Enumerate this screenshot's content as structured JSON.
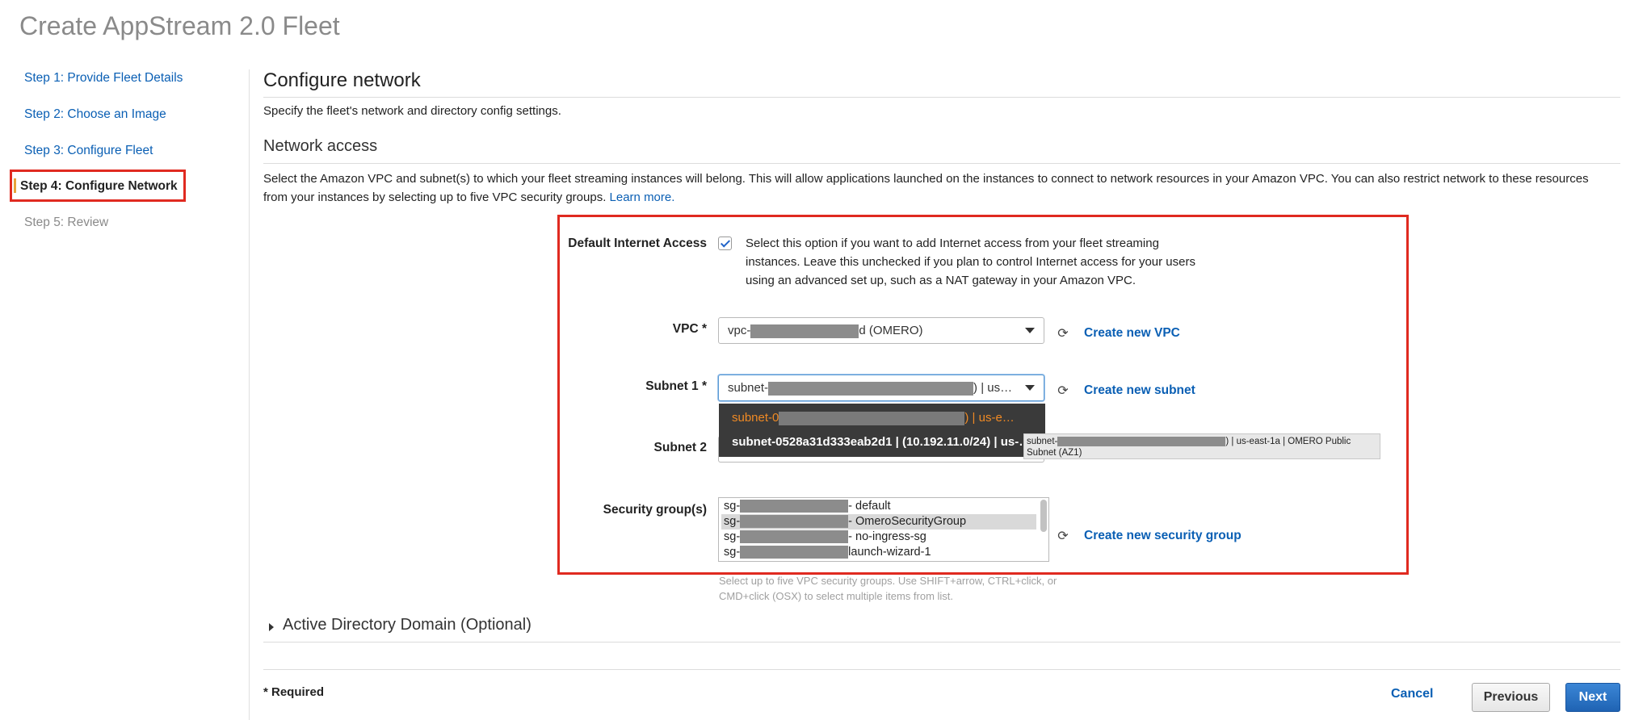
{
  "page": {
    "title": "Create AppStream 2.0 Fleet"
  },
  "steps": [
    {
      "label": "Step 1: Provide Fleet Details"
    },
    {
      "label": "Step 2: Choose an Image"
    },
    {
      "label": "Step 3: Configure Fleet"
    },
    {
      "label": "Step 4: Configure Network"
    },
    {
      "label": "Step 5: Review"
    }
  ],
  "main": {
    "title": "Configure network",
    "subtitle": "Specify the fleet's network and directory config settings.",
    "network_access": {
      "heading": "Network access",
      "description": "Select the Amazon VPC and subnet(s) to which your fleet streaming instances will belong. This will allow applications launched on the instances to connect to network resources in your Amazon VPC. You can also restrict network to these resources from your instances by selecting up to five VPC security groups.",
      "learn_more": "Learn more."
    },
    "default_internet": {
      "label": "Default Internet Access",
      "checked": true,
      "text": "Select this option if you want to add Internet access from your fleet streaming instances. Leave this unchecked if you plan to control Internet access for your users using an advanced set up, such as a NAT gateway in your Amazon VPC."
    },
    "vpc": {
      "label": "VPC *",
      "value_prefix": "vpc-",
      "value_suffix": "d (OMERO)",
      "create_link": "Create new VPC"
    },
    "subnet1": {
      "label": "Subnet 1 *",
      "value_prefix": "subnet-",
      "value_suffix": ") | us…",
      "create_link": "Create new subnet",
      "dropdown_options": [
        {
          "prefix": "subnet-0",
          "suffix": ") | us-e…",
          "state": "selected"
        },
        {
          "text": "subnet-0528a31d333eab2d1 | (10.192.11.0/24) | us-…",
          "state": "hover"
        }
      ],
      "tooltip_prefix": "subnet-",
      "tooltip_suffix": ") | us-east-1a | OMERO Public Subnet (AZ1)"
    },
    "subnet2": {
      "label": "Subnet 2"
    },
    "security_groups": {
      "label": "Security group(s)",
      "create_link": "Create new security group",
      "items": [
        {
          "prefix": "sg-",
          "suffix": "- default",
          "selected": false
        },
        {
          "prefix": "sg-",
          "suffix": "- OmeroSecurityGroup",
          "selected": true
        },
        {
          "prefix": "sg-",
          "suffix": "- no-ingress-sg",
          "selected": false
        },
        {
          "prefix": "sg-",
          "suffix": "launch-wizard-1",
          "selected": false
        }
      ],
      "hint": "Select up to five VPC security groups. Use SHIFT+arrow, CTRL+click, or CMD+click (OSX) to select multiple items from list."
    },
    "active_directory": {
      "label": "Active Directory Domain (Optional)"
    },
    "required_note": "* Required"
  },
  "footer": {
    "cancel": "Cancel",
    "previous": "Previous",
    "next": "Next"
  },
  "colors": {
    "link": "#0a5fb4",
    "highlight_border": "#e02a20",
    "primary_button": "#1f63b3",
    "dropdown_bg": "#3a3a3a",
    "dropdown_selected_text": "#f08a24"
  }
}
